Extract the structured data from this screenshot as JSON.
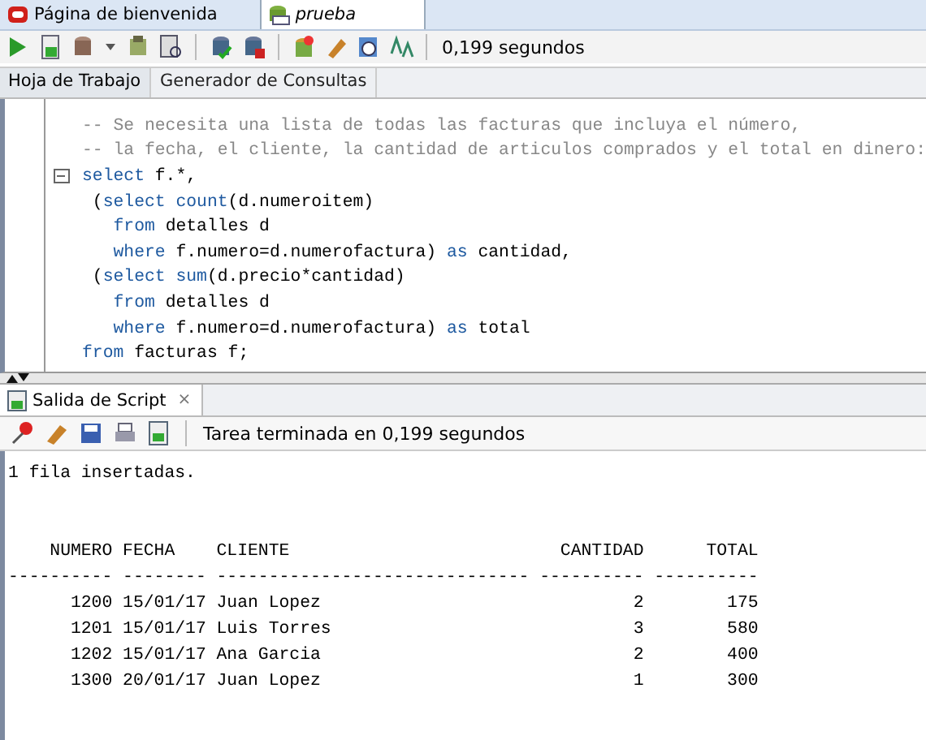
{
  "document_tabs": [
    {
      "label": "Página de bienvenida",
      "selected": false
    },
    {
      "label": "prueba",
      "selected": true
    }
  ],
  "toolbar": {
    "elapsed": "0,199 segundos"
  },
  "worksheet_tabs": [
    {
      "label": "Hoja de Trabajo",
      "selected": true
    },
    {
      "label": "Generador de Consultas",
      "selected": false
    }
  ],
  "editor": {
    "lines": [
      {
        "tokens": [
          {
            "kind": "comment",
            "text": "-- Se necesita una lista de todas las facturas que incluya el número,"
          }
        ]
      },
      {
        "tokens": [
          {
            "kind": "comment",
            "text": "-- la fecha, el cliente, la cantidad de articulos comprados y el total en dinero:"
          }
        ]
      },
      {
        "fold": true,
        "tokens": [
          {
            "kind": "keyword",
            "text": "select"
          },
          {
            "kind": "plain",
            "text": " f.*,"
          }
        ]
      },
      {
        "tokens": [
          {
            "kind": "plain",
            "text": " ("
          },
          {
            "kind": "keyword",
            "text": "select count"
          },
          {
            "kind": "plain",
            "text": "(d.numeroitem)"
          }
        ]
      },
      {
        "tokens": [
          {
            "kind": "keyword",
            "text": "   from"
          },
          {
            "kind": "plain",
            "text": " detalles d"
          }
        ]
      },
      {
        "tokens": [
          {
            "kind": "keyword",
            "text": "   where"
          },
          {
            "kind": "plain",
            "text": " f.numero=d.numerofactura) "
          },
          {
            "kind": "keyword",
            "text": "as"
          },
          {
            "kind": "plain",
            "text": " cantidad,"
          }
        ]
      },
      {
        "tokens": [
          {
            "kind": "plain",
            "text": " ("
          },
          {
            "kind": "keyword",
            "text": "select sum"
          },
          {
            "kind": "plain",
            "text": "(d.precio*cantidad)"
          }
        ]
      },
      {
        "tokens": [
          {
            "kind": "keyword",
            "text": "   from"
          },
          {
            "kind": "plain",
            "text": " detalles d"
          }
        ]
      },
      {
        "tokens": [
          {
            "kind": "keyword",
            "text": "   where"
          },
          {
            "kind": "plain",
            "text": " f.numero=d.numerofactura) "
          },
          {
            "kind": "keyword",
            "text": "as"
          },
          {
            "kind": "plain",
            "text": " total"
          }
        ]
      },
      {
        "tokens": [
          {
            "kind": "keyword",
            "text": "from"
          },
          {
            "kind": "plain",
            "text": " facturas f;"
          }
        ]
      }
    ]
  },
  "output_panel": {
    "tab": {
      "label": "Salida de Script",
      "close": "×"
    },
    "status": "Tarea terminada en 0,199 segundos",
    "message": "1 fila insertadas.",
    "result_lines": [
      "    NUMERO FECHA    CLIENTE                          CANTIDAD      TOTAL",
      "---------- -------- ------------------------------ ---------- ----------",
      "      1200 15/01/17 Juan Lopez                              2        175",
      "      1201 15/01/17 Luis Torres                             3        580",
      "      1202 15/01/17 Ana Garcia                              2        400",
      "      1300 20/01/17 Juan Lopez                              1        300"
    ]
  }
}
